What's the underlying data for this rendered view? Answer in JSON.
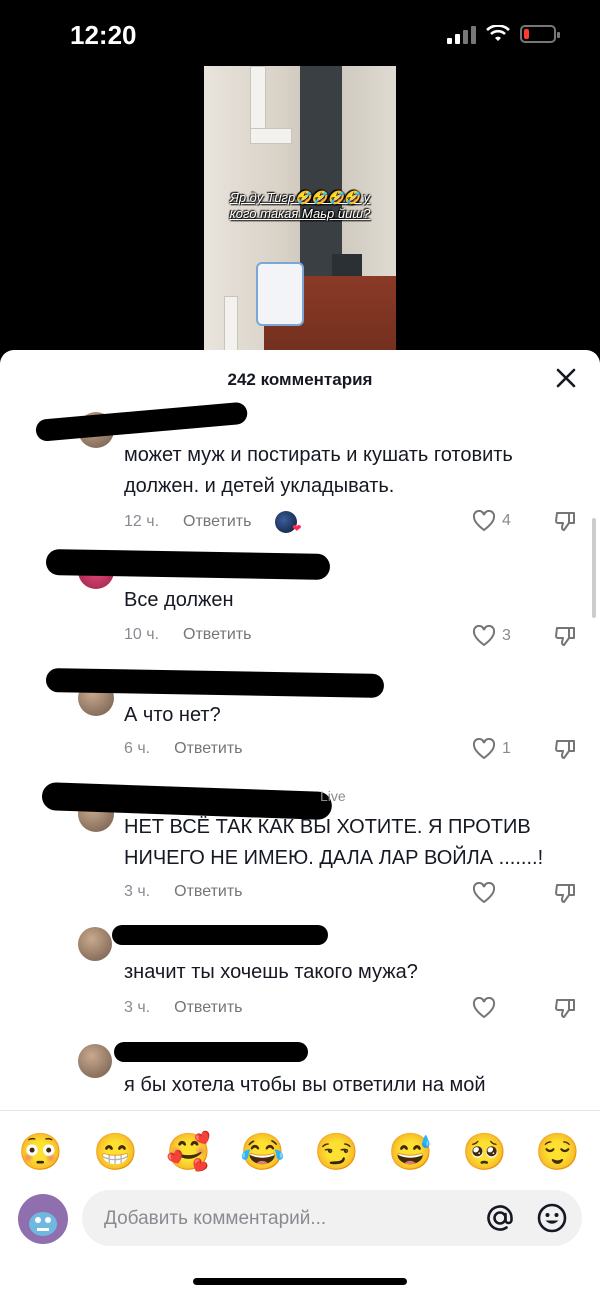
{
  "status": {
    "time": "12:20"
  },
  "video": {
    "caption_line1": "Яр ду Тигр🤣🤣🤣🤣 у",
    "caption_line2": "кого такая Маьр йиш?"
  },
  "sheet": {
    "title": "242 комментария"
  },
  "comments": [
    {
      "user_visible": "",
      "text_lines": [
        "может муж и постирать и кушать готовить",
        "должен. и детей укладывать."
      ],
      "time": "12 ч.",
      "reply": "Ответить",
      "likes": "4"
    },
    {
      "user_visible": "",
      "text_lines": [
        "Все должен"
      ],
      "time": "10 ч.",
      "reply": "Ответить",
      "likes": "3"
    },
    {
      "user_visible": "",
      "text_lines": [
        "А что нет?"
      ],
      "time": "6 ч.",
      "reply": "Ответить",
      "likes": "1"
    },
    {
      "user_visible": "Live",
      "text_lines": [
        "НЕТ ВСЁ ТАК КАК ВЫ ХОТИТЕ. Я ПРОТИВ",
        "НИЧЕГО НЕ ИМЕЮ. ДАЛА ЛАР ВОЙЛА .......!"
      ],
      "time": "3 ч.",
      "reply": "Ответить",
      "likes": ""
    },
    {
      "user_visible": "",
      "text_lines": [
        "значит ты хочешь такого мужа?"
      ],
      "time": "3 ч.",
      "reply": "Ответить",
      "likes": ""
    },
    {
      "user_visible": "",
      "text_lines": [
        "я бы хотела чтобы вы ответили на мой"
      ],
      "time": "",
      "reply": "",
      "likes": ""
    }
  ],
  "emojis": [
    "😳",
    "😁",
    "🥰",
    "😂",
    "😏",
    "😅",
    "🥺",
    "😌"
  ],
  "composer": {
    "placeholder": "Добавить комментарий..."
  },
  "colors": {
    "sheet_bg": "#ffffff",
    "text": "#161823",
    "secondary": "#8a8b91",
    "input_bg": "#f1f1f2"
  }
}
